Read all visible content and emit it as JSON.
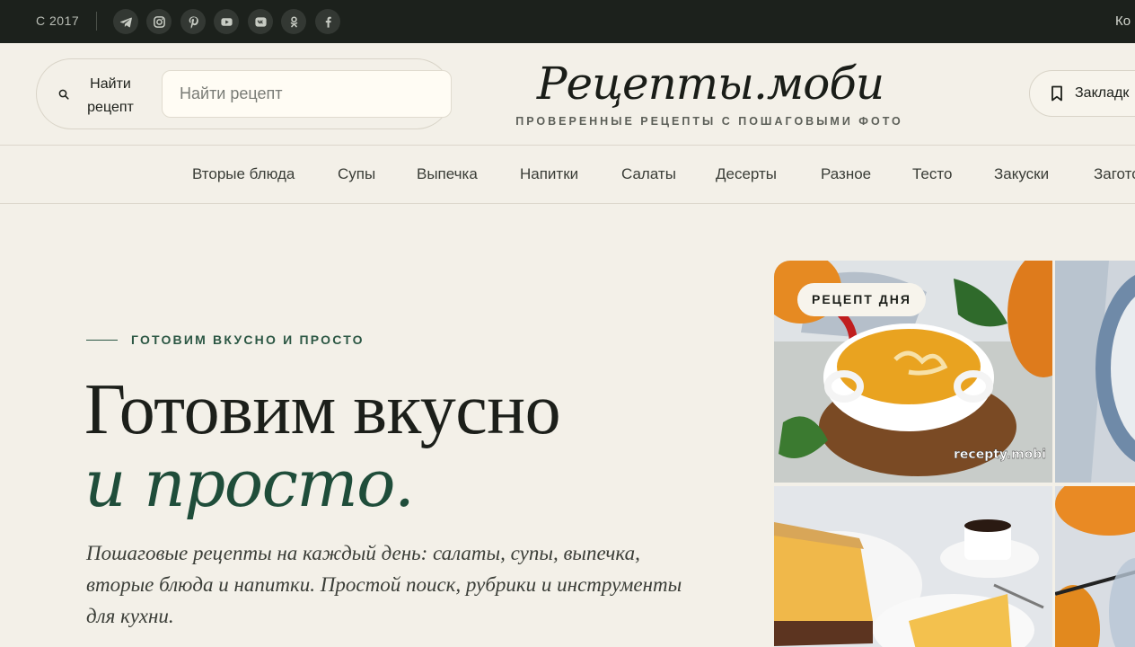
{
  "topbar": {
    "copyright": "С 2017",
    "socials": [
      "telegram-icon",
      "instagram-icon",
      "pinterest-icon",
      "youtube-icon",
      "vk-icon",
      "odnoklassniki-icon",
      "facebook-icon"
    ],
    "right_link": "Ко"
  },
  "header": {
    "search_label": "Найти рецепт",
    "search_placeholder": "Найти рецепт",
    "logo": "Рецепты.моби",
    "tagline": "ПРОВЕРЕННЫЕ РЕЦЕПТЫ С ПОШАГОВЫМИ ФОТО",
    "bookmarks_label": "Закладк"
  },
  "nav": {
    "items": [
      "Вторые блюда",
      "Супы",
      "Выпечка",
      "Напитки",
      "Салаты",
      "Десерты",
      "Разное",
      "Тесто",
      "Закуски",
      "Загото"
    ]
  },
  "hero": {
    "eyebrow": "ГОТОВИМ ВКУСНО И ПРОСТО",
    "title_line1": "Готовим вкусно",
    "title_line2": "и просто.",
    "lead": "Пошаговые рецепты на каждый день: салаты, супы, выпечка, вторые блюда и напитки. Простой поиск, рубрики и инструменты для кухни."
  },
  "gallery": {
    "badge": "РЕЦЕПТ ДНЯ",
    "watermark": "recepty.mobi"
  },
  "colors": {
    "topbar_bg": "#1c211c",
    "page_bg": "#f3f0e8",
    "accent_green": "#1f4d3a"
  }
}
